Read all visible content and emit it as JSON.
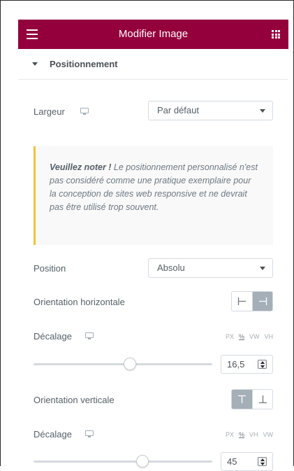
{
  "header": {
    "title": "Modifier Image",
    "menu_icon": "hamburger-menu-icon",
    "apps_icon": "grid-icon",
    "background": "#93003c"
  },
  "section": {
    "title": "Positionnement"
  },
  "width_control": {
    "label": "Largeur",
    "value": "Par défaut"
  },
  "notice": {
    "strong": "Veuillez noter !",
    "text": " Le positionnement personnalisé n'est pas considéré comme une pratique exemplaire pour la conception de sites web responsive et ne devrait pas être utilisé trop souvent.",
    "accent": "#f0c33c"
  },
  "position_control": {
    "label": "Position",
    "value": "Absolu"
  },
  "horizontal_orientation": {
    "label": "Orientation horizontale",
    "options": [
      "left",
      "right"
    ],
    "selected": "right"
  },
  "horizontal_offset": {
    "label": "Décalage",
    "units": [
      "PX",
      "%",
      "VW",
      "VH"
    ],
    "active_unit": "%",
    "value": "16,5",
    "slider_fraction": 0.54
  },
  "vertical_orientation": {
    "label": "Orientation verticale",
    "options": [
      "top",
      "bottom"
    ],
    "selected": "top"
  },
  "vertical_offset": {
    "label": "Décalage",
    "units": [
      "PX",
      "%",
      "VH",
      "VW"
    ],
    "active_unit": "%",
    "value": "45",
    "slider_fraction": 0.61
  }
}
